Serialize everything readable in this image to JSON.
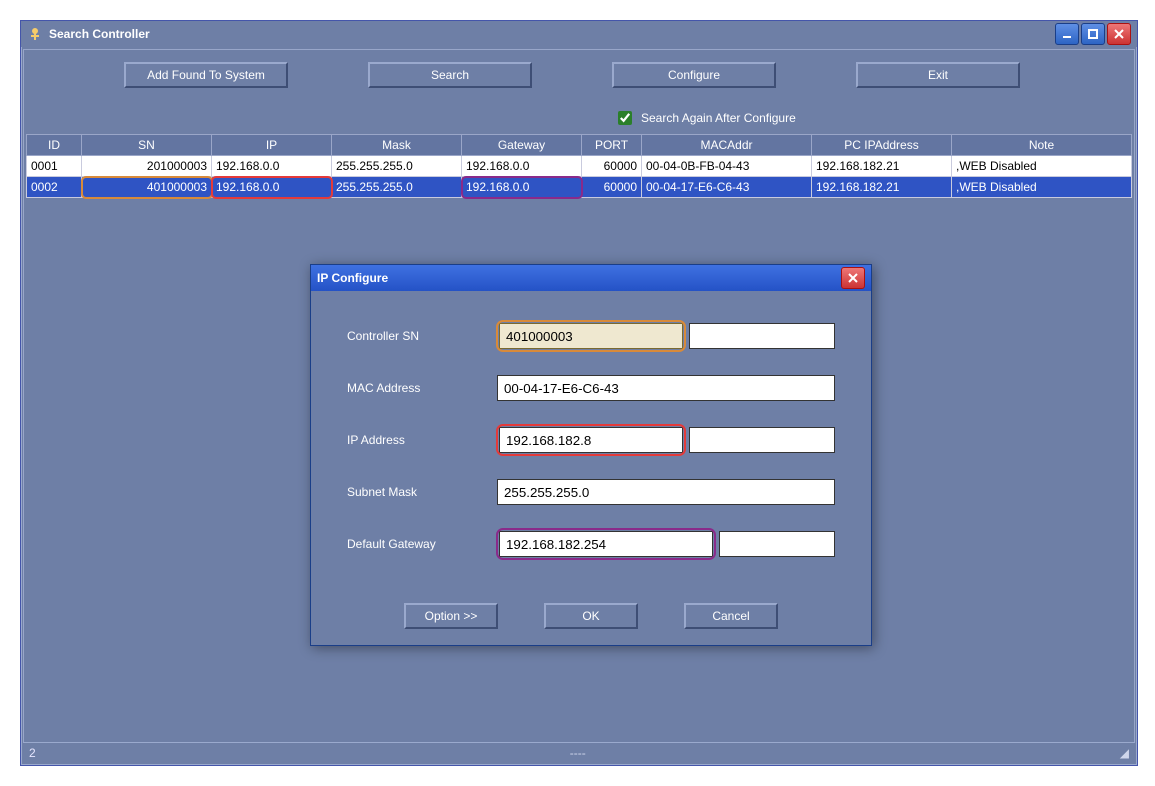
{
  "window": {
    "title": "Search Controller",
    "icon_name": "search-controller-icon"
  },
  "toolbar": {
    "add_found": "Add Found To System",
    "search": "Search",
    "configure": "Configure",
    "exit": "Exit"
  },
  "checkbox": {
    "label": "Search Again After Configure",
    "checked": true
  },
  "table": {
    "headers": [
      "ID",
      "SN",
      "IP",
      "Mask",
      "Gateway",
      "PORT",
      "MACAddr",
      "PC IPAddress",
      "Note"
    ],
    "rows": [
      {
        "selected": false,
        "cells": [
          "0001",
          "201000003",
          "192.168.0.0",
          "255.255.255.0",
          "192.168.0.0",
          "60000",
          "00-04-0B-FB-04-43",
          "192.168.182.21",
          ",WEB Disabled"
        ]
      },
      {
        "selected": true,
        "cells": [
          "0002",
          "401000003",
          "192.168.0.0",
          "255.255.255.0",
          "192.168.0.0",
          "60000",
          "00-04-17-E6-C6-43",
          "192.168.182.21",
          ",WEB Disabled"
        ]
      }
    ]
  },
  "dialog": {
    "title": "IP Configure",
    "fields": {
      "controller_sn_label": "Controller SN",
      "controller_sn": "401000003",
      "mac_label": "MAC Address",
      "mac": "00-04-17-E6-C6-43",
      "ip_label": "IP Address",
      "ip": "192.168.182.8",
      "mask_label": "Subnet Mask",
      "mask": "255.255.255.0",
      "gateway_label": "Default Gateway",
      "gateway": "192.168.182.254"
    },
    "buttons": {
      "option": "Option >>",
      "ok": "OK",
      "cancel": "Cancel"
    }
  },
  "status": {
    "count": "2",
    "right": "----"
  }
}
